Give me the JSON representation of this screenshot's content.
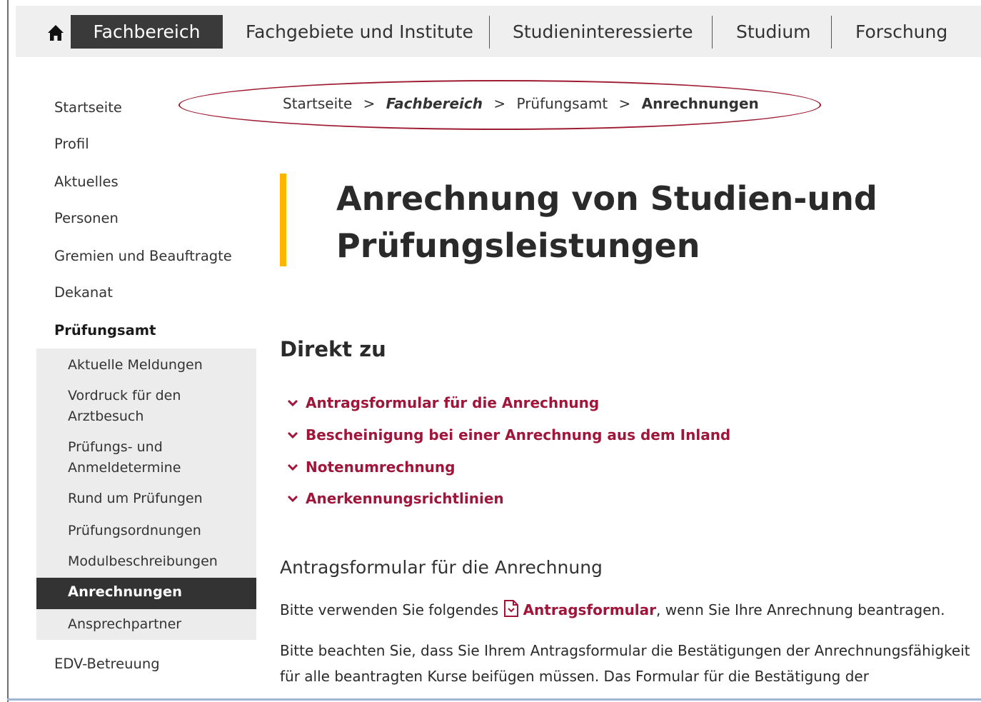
{
  "topnav": {
    "home_icon": "home-icon",
    "active": "Fachbereich",
    "items": [
      "Fachgebiete und Institute",
      "Studieninteressierte",
      "Studium",
      "Forschung"
    ]
  },
  "breadcrumb": {
    "items": [
      "Startseite",
      "Fachbereich",
      "Prüfungsamt",
      "Anrechnungen"
    ],
    "separator": ">"
  },
  "sidebar": {
    "items": [
      "Startseite",
      "Profil",
      "Aktuelles",
      "Personen",
      "Gremien und Beauftragte",
      "Dekanat"
    ],
    "current_section": "Prüfungsamt",
    "subitems": [
      "Aktuelle Meldungen",
      "Vordruck für den",
      "Arztbesuch",
      "Prüfungs- und",
      "Anmeldetermine",
      "Rund um Prüfungen",
      "Prüfungsordnungen",
      "Modulbeschreibungen"
    ],
    "active_subitem": "Anrechnungen",
    "after_active": "Ansprechpartner",
    "after_section": "EDV-Betreuung"
  },
  "main": {
    "title_line1": "Anrechnung von Studien-und",
    "title_line2": "Prüfungsleistungen",
    "direkt_heading": "Direkt zu",
    "links": [
      "Antragsformular für die Anrechnung",
      "Bescheinigung bei einer Anrechnung aus dem Inland",
      "Notenumrechnung",
      "Anerkennungsrichtlinien"
    ],
    "section_heading": "Antragsformular für die Anrechnung",
    "para1_before": "Bitte verwenden Sie folgendes",
    "para1_link": "Antragsformular",
    "para1_after": ", wenn Sie Ihre Anrechnung beantragen.",
    "para2_line1": "Bitte beachten Sie, dass Sie Ihrem Antragsformular die Bestätigungen der Anrechnungsfähigkeit",
    "para2_line2": "für alle beantragten Kurse beifügen müssen. Das Formular für die Bestätigung der"
  },
  "colors": {
    "accent": "#a0163a",
    "title_bar": "#ffb400",
    "nav_active": "#3a3a3a"
  }
}
